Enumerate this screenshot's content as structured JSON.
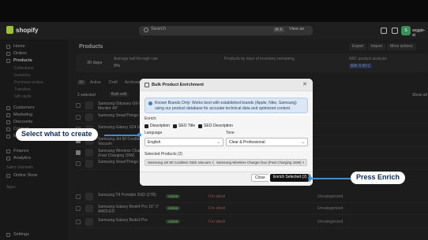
{
  "topbar": {
    "brand": "shopify",
    "search_placeholder": "Search",
    "kbd": "⌘ K",
    "view_as": "View as",
    "user": "seggie-st"
  },
  "sidebar": {
    "items": [
      "Home",
      "Orders",
      "Products",
      "Customers",
      "Marketing",
      "Discounts",
      "Content",
      "Markets",
      "Finance",
      "Analytics",
      "Online Store"
    ],
    "subitems": [
      "Collections",
      "Inventory",
      "Purchase orders",
      "Transfers",
      "Gift cards"
    ],
    "sales_channels": "Sales channels",
    "apps": "Apps",
    "settings": "Settings"
  },
  "page": {
    "title": "Products",
    "export": "Export",
    "import": "Import",
    "more_actions": "More actions"
  },
  "metrics": {
    "days": "30 days",
    "sell_through_label": "Average sell-through rate",
    "sell_through_value": "0%",
    "days_inventory_label": "Products by days of inventory remaining",
    "abc_label": "ABC product analysis",
    "abc_value": "$0K 0.00 C"
  },
  "tabs": [
    "All",
    "Active",
    "Draft",
    "Archived"
  ],
  "bulk": {
    "selected": "2 selected",
    "bulk_edit": "Bulk edit",
    "show_all": "Show all"
  },
  "rows": [
    {
      "name": "Samsung Odyssey G9 Gaming Monitor 49\"",
      "checked": false
    },
    {
      "name": "Samsung SmartThings Smart...",
      "checked": false
    },
    {
      "name": "Samsung Galaxy S24 Ultra 512GB",
      "checked": false
    },
    {
      "name": "Samsung Jet 60 Cordless Stick Vacuum",
      "checked": true
    },
    {
      "name": "Samsung Wireless Charger Duo (Fast Charging 15W)",
      "checked": true
    },
    {
      "name": "Samsung SmartThings Station",
      "checked": false
    },
    {
      "name": "Samsung T9 Portable SSD (2TB)",
      "checked": false,
      "status": "Active",
      "inv": "0 in stock",
      "cat": "Uncategorized"
    },
    {
      "name": "Samsung Galaxy Book4 Pro 16\" i7 AMOLED",
      "checked": false,
      "status": "Active",
      "inv": "0 in stock",
      "cat": "Uncategorized"
    },
    {
      "name": "Samsung Galaxy Buds3 Pro",
      "checked": false,
      "status": "Active",
      "inv": "0 in stock",
      "cat": "Uncategorized"
    }
  ],
  "modal": {
    "title": "Bulk Product Enrichment",
    "info": "Known Brands Only: Works best with established brands (Apple, Nike, Samsung) using our product database for accurate technical data and optimized content.",
    "enrich_label": "Enrich:",
    "options": [
      "Description",
      "SEO Title",
      "SEO Description"
    ],
    "language_label": "Language",
    "language_value": "English",
    "tone_label": "Tone",
    "tone_value": "Clear & Professional",
    "selected_label": "Selected Products (2)",
    "selected_products": [
      "Samsung Jet 60 Cordless Stick Vacuum ×",
      "Samsung Wireless Charger Duo (Fast Charging 15W) ×"
    ],
    "close": "Close",
    "enrich_button": "Enrich Selected (2)"
  },
  "callouts": {
    "left": "Select what to create",
    "right": "Press Enrich"
  },
  "colors": {
    "accent_blue": "#3d8ed8",
    "callout_text": "#0d2a55"
  }
}
